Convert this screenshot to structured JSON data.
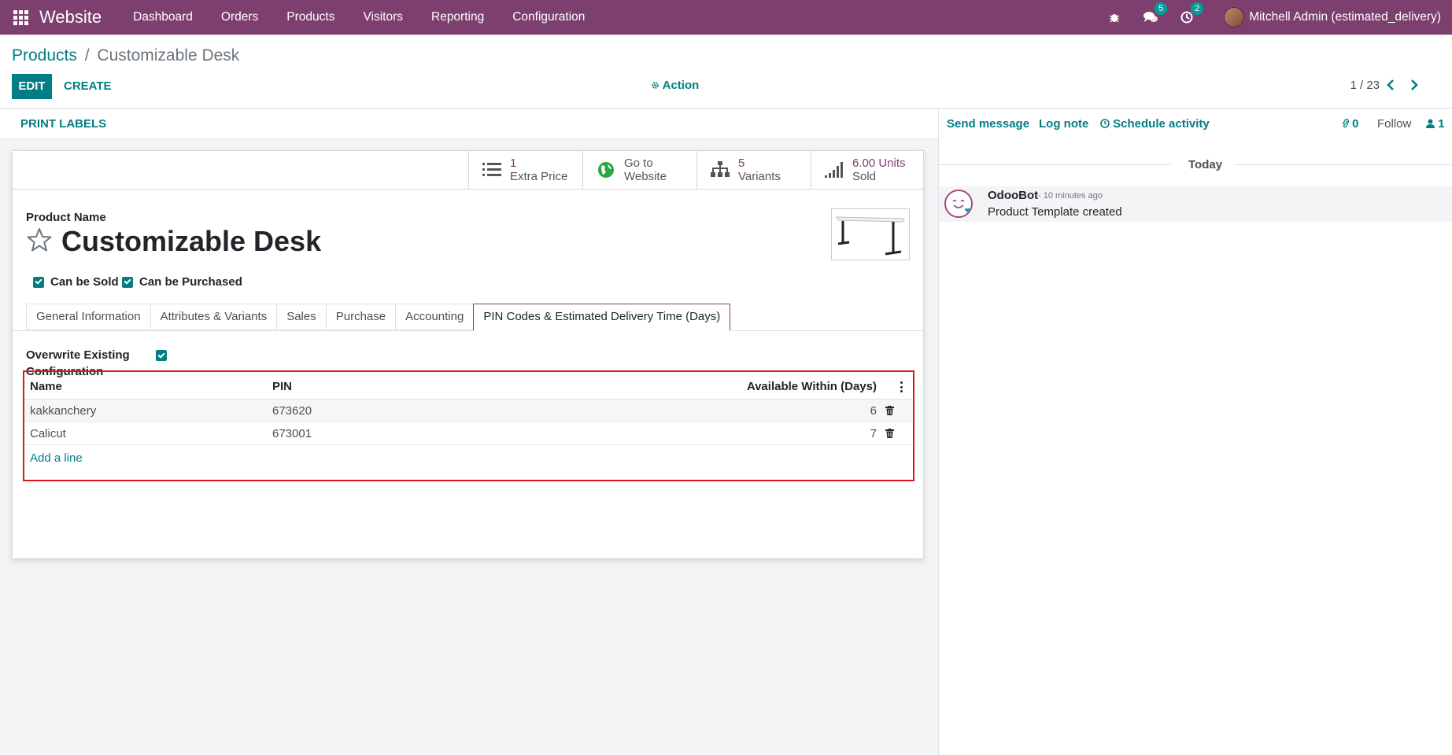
{
  "navbar": {
    "brand": "Website",
    "menu": [
      "Dashboard",
      "Orders",
      "Products",
      "Visitors",
      "Reporting",
      "Configuration"
    ],
    "messages_count": "5",
    "activities_count": "2",
    "user": "Mitchell Admin (estimated_delivery)"
  },
  "breadcrumb": {
    "parent": "Products",
    "separator": "/",
    "current": "Customizable Desk"
  },
  "toolbar": {
    "edit": "EDIT",
    "create": "CREATE",
    "action": "Action",
    "pager": "1 / 23"
  },
  "statusbar": {
    "print_labels": "PRINT LABELS"
  },
  "smart_buttons": [
    {
      "value": "1",
      "label": "Extra Price",
      "icon": "list-icon"
    },
    {
      "value": "Go to",
      "label": "Website",
      "icon": "globe-icon"
    },
    {
      "value": "5",
      "label": "Variants",
      "icon": "sitemap-icon"
    },
    {
      "value": "6.00 Units",
      "label": "Sold",
      "icon": "signal-icon"
    }
  ],
  "product": {
    "name_label": "Product Name",
    "name": "Customizable Desk",
    "can_be_sold": "Can be Sold",
    "can_be_purchased": "Can be Purchased"
  },
  "tabs": [
    "General Information",
    "Attributes & Variants",
    "Sales",
    "Purchase",
    "Accounting",
    "PIN Codes & Estimated Delivery Time (Days)"
  ],
  "overwrite": {
    "label_line1": "Overwrite Existing",
    "label_line2": "Configuration"
  },
  "pin_table": {
    "headers": {
      "name": "Name",
      "pin": "PIN",
      "available": "Available Within (Days)"
    },
    "rows": [
      {
        "name": "kakkanchery",
        "pin": "673620",
        "days": "6"
      },
      {
        "name": "Calicut",
        "pin": "673001",
        "days": "7"
      }
    ],
    "add_line": "Add a line"
  },
  "chatter": {
    "send_message": "Send message",
    "log_note": "Log note",
    "schedule_activity": "Schedule activity",
    "attachments": "0",
    "follow": "Follow",
    "followers": "1",
    "date_separator": "Today",
    "messages": [
      {
        "author": "OdooBot",
        "time": "- 10 minutes ago",
        "body": "Product Template created"
      }
    ]
  },
  "colors": {
    "navbar": "#7c3f6e",
    "accent": "#017e84",
    "highlight_border": "#e0141e"
  }
}
